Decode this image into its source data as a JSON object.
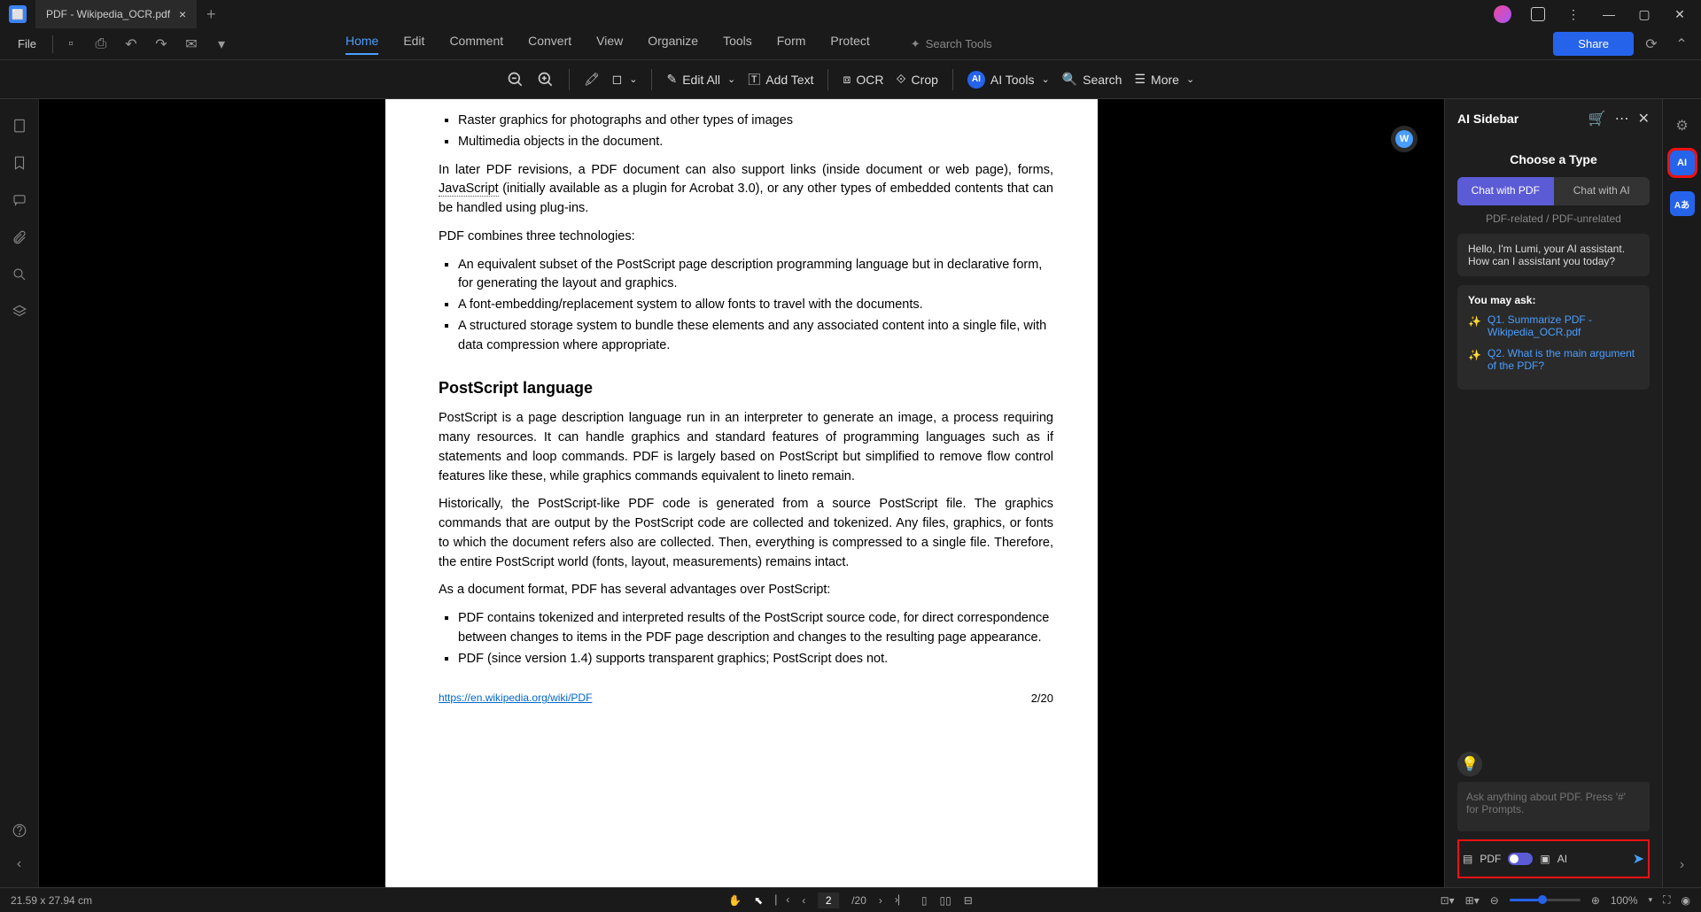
{
  "tab": {
    "title": "PDF - Wikipedia_OCR.pdf"
  },
  "menu": {
    "file": "File",
    "tabs": [
      "Home",
      "Edit",
      "Comment",
      "Convert",
      "View",
      "Organize",
      "Tools",
      "Form",
      "Protect"
    ],
    "active": "Home",
    "search_tools": "Search Tools",
    "share": "Share"
  },
  "toolbar": {
    "edit_all": "Edit All",
    "add_text": "Add Text",
    "ocr": "OCR",
    "crop": "Crop",
    "ai_tools": "AI Tools",
    "search": "Search",
    "more": "More"
  },
  "document": {
    "bullets_top": [
      "Raster graphics for photographs and other types of images",
      "Multimedia objects in the document."
    ],
    "p1_a": "In later PDF revisions, a PDF document can also support links (inside document or web page), forms, ",
    "p1_link": "JavaScript",
    "p1_b": " (initially available as a plugin for Acrobat 3.0), or any other types of embedded contents that can be handled using plug-ins.",
    "p2": "PDF combines three technologies:",
    "bullets_tech": [
      "An equivalent subset of the PostScript page description programming language but in declarative form, for generating the layout and graphics.",
      "A font-embedding/replacement system to allow fonts to travel with the documents.",
      "A structured storage system to bundle these elements and any associated content into a single file, with data compression where appropriate."
    ],
    "h3": "PostScript language",
    "p3": "PostScript is a page description language run in an interpreter to generate an image, a process requiring many resources. It can handle graphics and standard features of programming languages such as if statements and loop commands. PDF is largely based on PostScript but simplified to remove flow control features like these, while graphics commands equivalent to lineto remain.",
    "p4": "Historically, the PostScript-like PDF code is generated from a source PostScript file. The graphics commands that are output by the PostScript code are collected and tokenized. Any files, graphics, or fonts to which the document refers also are collected. Then, everything is compressed to a single file. Therefore, the entire PostScript world (fonts, layout, measurements) remains intact.",
    "p5": "As a document format, PDF has several advantages over PostScript:",
    "bullets_adv": [
      "PDF contains tokenized and interpreted results of the PostScript source code, for direct correspondence between changes to items in the PDF page description and changes to the resulting page appearance.",
      "PDF (since version 1.4) supports transparent graphics; PostScript does not."
    ],
    "footer_link": "https://en.wikipedia.org/wiki/PDF",
    "footer_page": "2/20"
  },
  "sidebar": {
    "title": "AI Sidebar",
    "choose": "Choose a Type",
    "chat_pdf": "Chat with PDF",
    "chat_ai": "Chat with AI",
    "subtext": "PDF-related / PDF-unrelated",
    "greeting": "Hello, I'm Lumi, your AI assistant. How can I assistant you today?",
    "you_may_ask": "You may ask:",
    "q1": "Q1. Summarize PDF - Wikipedia_OCR.pdf",
    "q2": "Q2. What is the main argument of the PDF?",
    "input_placeholder": "Ask anything about PDF. Press '#' for Prompts.",
    "mode_pdf": "PDF",
    "mode_ai": "AI"
  },
  "status": {
    "dims": "21.59 x 27.94 cm",
    "page_current": "2",
    "page_total": "/20",
    "zoom": "100%"
  }
}
